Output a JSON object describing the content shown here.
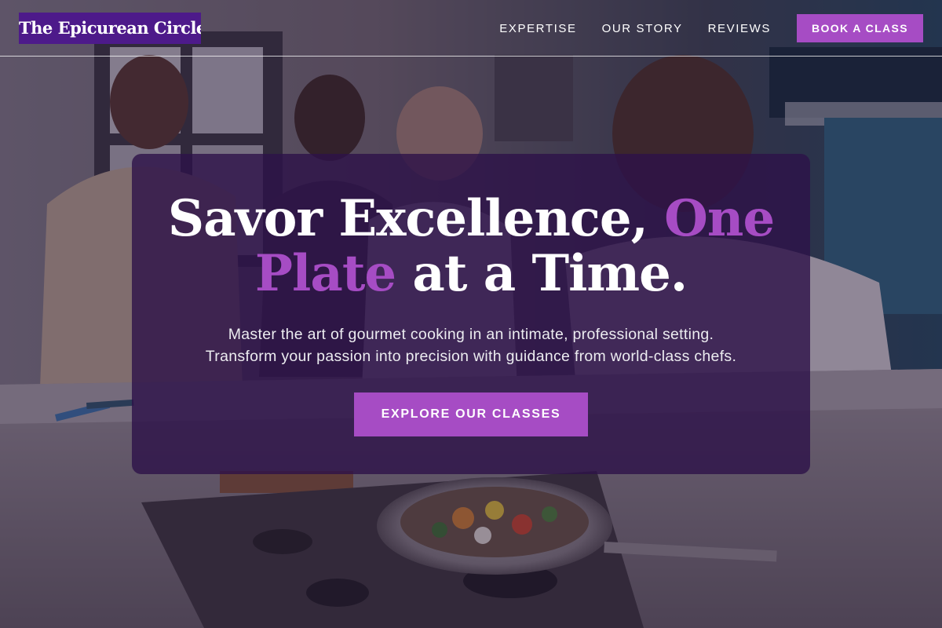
{
  "brand": {
    "name": "The Epicurean Circle"
  },
  "nav": {
    "items": [
      {
        "label": "EXPERTISE"
      },
      {
        "label": "OUR STORY"
      },
      {
        "label": "REVIEWS"
      }
    ],
    "cta_label": "BOOK A CLASS"
  },
  "hero": {
    "title_part1": "Savor Excellence, ",
    "title_accent": "One Plate",
    "title_part2": " at a Time.",
    "subtitle_line1": "Master the art of gourmet cooking in an intimate, professional setting.",
    "subtitle_line2": "Transform your passion into precision with guidance from world-class chefs.",
    "cta_label": "EXPLORE OUR CLASSES"
  },
  "colors": {
    "brand_purple": "#4d1a8a",
    "accent_purple": "#a64cc4",
    "card_overlay": "#2d1248"
  }
}
